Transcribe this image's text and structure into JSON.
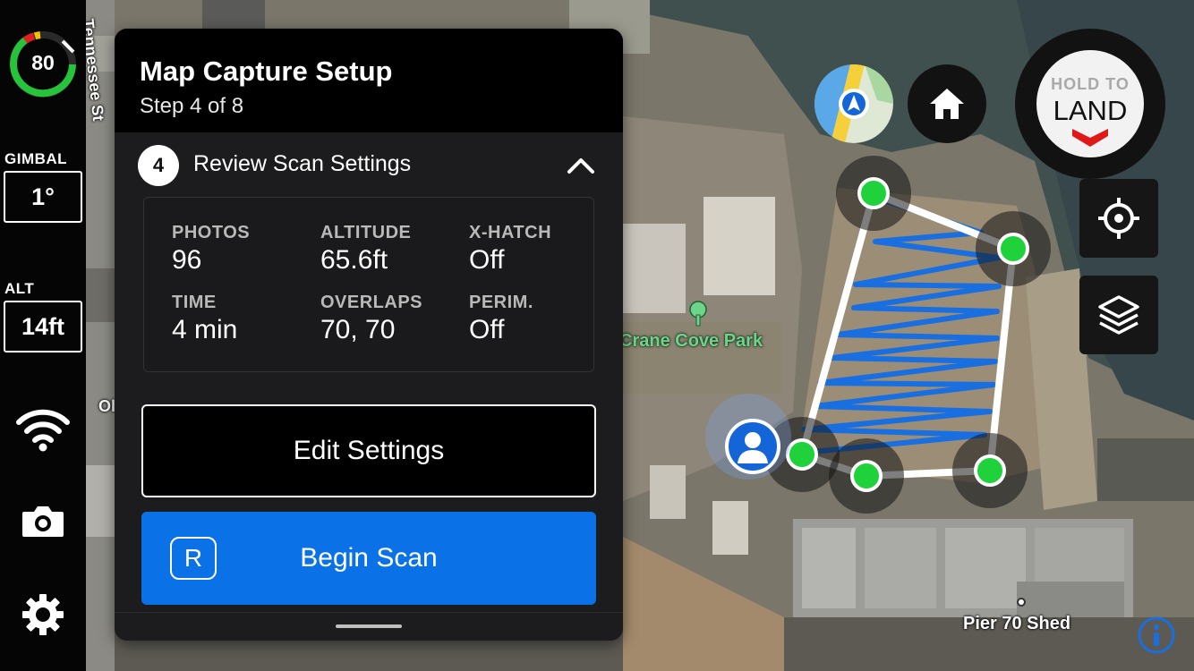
{
  "telemetry": {
    "battery_percent": "80",
    "gimbal_label": "GIMBAL",
    "gimbal_value": "1°",
    "alt_label": "ALT",
    "alt_value": "14ft"
  },
  "rail_icons": {
    "wifi": "wifi-icon",
    "camera": "camera-icon",
    "settings": "gear-icon"
  },
  "panel": {
    "title": "Map Capture Setup",
    "subtitle": "Step 4 of 8",
    "step_number": "4",
    "step_label": "Review Scan Settings",
    "stats": [
      {
        "label": "PHOTOS",
        "value": "96"
      },
      {
        "label": "ALTITUDE",
        "value": "65.6ft"
      },
      {
        "label": "X-HATCH",
        "value": "Off"
      },
      {
        "label": "TIME",
        "value": "4 min"
      },
      {
        "label": "OVERLAPS",
        "value": "70, 70"
      },
      {
        "label": "PERIM.",
        "value": "Off"
      }
    ],
    "edit_button": "Edit Settings",
    "begin_button": "Begin Scan",
    "begin_badge": "R"
  },
  "controls": {
    "land_hold": "HOLD TO",
    "land_text": "LAND"
  },
  "map": {
    "street_label": "Tennessee St",
    "park_label": "Crane Cove Park",
    "pier_label": "Pier 70 Shed",
    "partial_label": "Ol"
  },
  "colors": {
    "accent_blue": "#0a72e6",
    "waypoint_green": "#1fd13a",
    "battery_green": "#26c43a",
    "battery_red": "#e02020",
    "land_red": "#e01818",
    "flight_path_blue": "#1a6fe0"
  }
}
